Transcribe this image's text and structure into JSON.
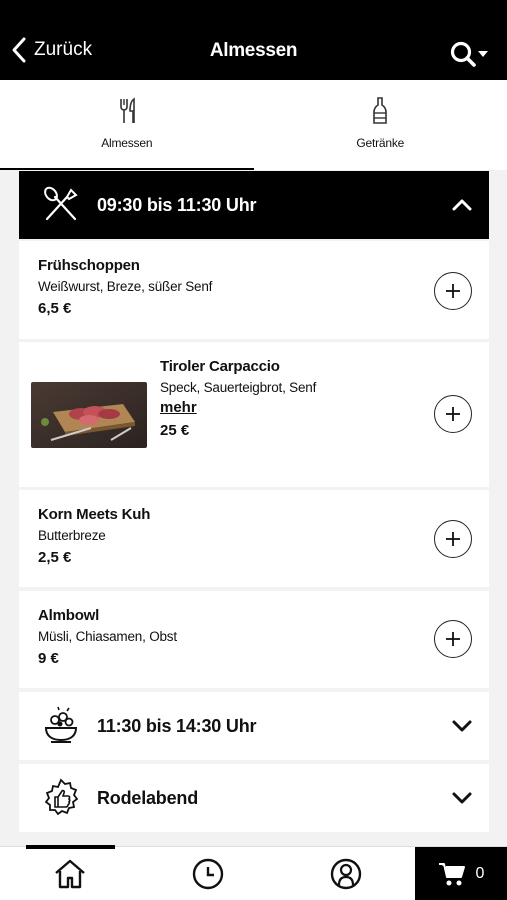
{
  "header": {
    "back_label": "Zurück",
    "title": "Almessen"
  },
  "tabs": [
    {
      "label": "Almessen",
      "icon": "cutlery-icon",
      "active": true
    },
    {
      "label": "Getränke",
      "icon": "bottle-icon",
      "active": false
    }
  ],
  "sections": [
    {
      "title": "09:30 bis 11:30 Uhr",
      "icon": "fork-knife-cross-icon",
      "expanded": true,
      "items": [
        {
          "name": "Frühschoppen",
          "description": "Weißwurst, Breze, süßer Senf",
          "price": "6,5 €"
        },
        {
          "name": "Tiroler Carpaccio",
          "description": "Speck, Sauerteigbrot, Senf",
          "more": "mehr",
          "price": "25 €",
          "image": "carpaccio-photo"
        },
        {
          "name": "Korn Meets Kuh",
          "description": "Butterbreze",
          "price": "2,5 €"
        },
        {
          "name": "Almbowl",
          "description": "Müsli, Chiasamen, Obst",
          "price": "9 €"
        }
      ]
    },
    {
      "title": "11:30 bis 14:30 Uhr",
      "icon": "salad-bowl-icon",
      "expanded": false
    },
    {
      "title": "Rodelabend",
      "icon": "thumbs-up-badge-icon",
      "expanded": false
    }
  ],
  "bottom_nav": {
    "items": [
      "home-icon",
      "clock-icon",
      "profile-icon"
    ],
    "cart_count": "0"
  }
}
